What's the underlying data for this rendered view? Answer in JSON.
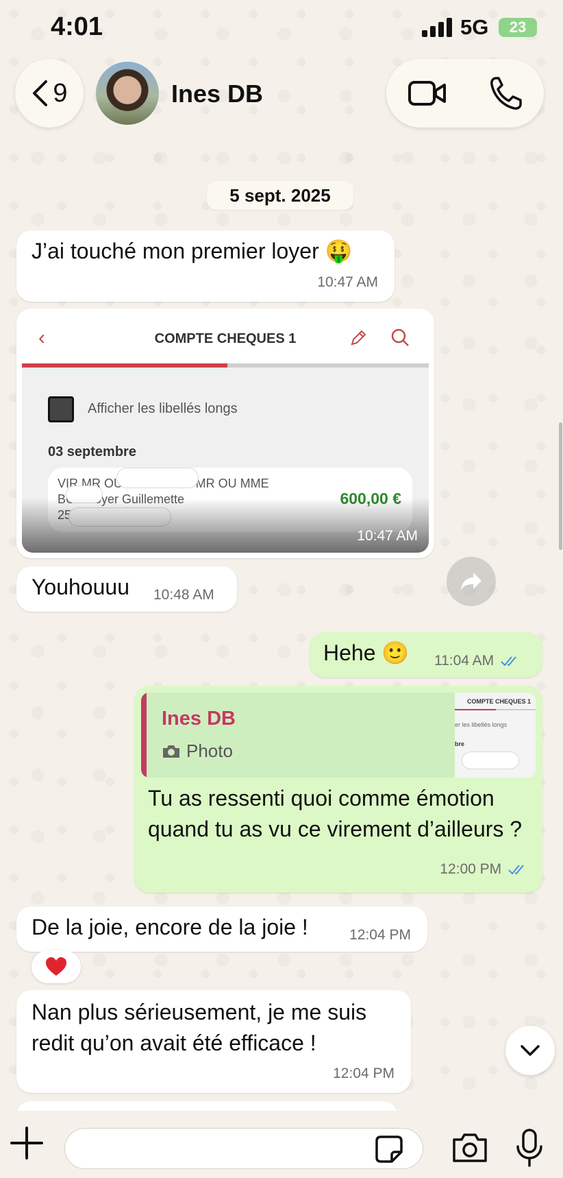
{
  "status_bar": {
    "time": "4:01",
    "network": "5G",
    "battery": "23"
  },
  "header": {
    "back_count": "9",
    "contact_name": "Ines  DB"
  },
  "chat": {
    "date_separator": "5 sept. 2025",
    "messages": [
      {
        "direction": "incoming",
        "text": "J’ai touché mon premier loyer 🤑",
        "time": "10:47 AM"
      },
      {
        "direction": "incoming",
        "type": "image",
        "time": "10:47 AM",
        "image": {
          "title": "COMPTE CHEQUES 1",
          "checkbox_label": "Afficher les libellés longs",
          "date": "03 septembre",
          "tx_line1": "VIR MR OU MME BOUT    MR OU MME",
          "tx_line2": "BOU     Loyer Guillemette",
          "tx_line3": "25",
          "amount": "600,00 €"
        }
      },
      {
        "direction": "incoming",
        "text": "Youhouuu",
        "time": "10:48 AM"
      },
      {
        "direction": "outgoing",
        "text": "Hehe 🙂",
        "time": "11:04 AM",
        "status": "read"
      },
      {
        "direction": "outgoing",
        "reply_to": {
          "author": "Ines  DB",
          "label": "Photo",
          "thumb_title": "COMPTE CHEQUES 1",
          "thumb_line1": "er les libellés longs",
          "thumb_line2": "bre"
        },
        "text": "Tu as ressenti quoi comme émotion quand tu as vu ce virement d’ailleurs ?",
        "time": "12:00 PM",
        "status": "read"
      },
      {
        "direction": "incoming",
        "text": "De la joie, encore de la joie !",
        "time": "12:04 PM",
        "reaction": "❤️"
      },
      {
        "direction": "incoming",
        "text": "Nan plus sérieusement, je me suis redit qu’on avait été efficace !",
        "time": "12:04 PM"
      }
    ]
  },
  "composer": {
    "message_value": ""
  },
  "colors": {
    "incoming_bubble": "#ffffff",
    "outgoing_bubble": "#dcf8c6",
    "read_ticks": "#4a90e2",
    "amount": "#2d8a2d",
    "quote_accent": "#c23b63"
  }
}
